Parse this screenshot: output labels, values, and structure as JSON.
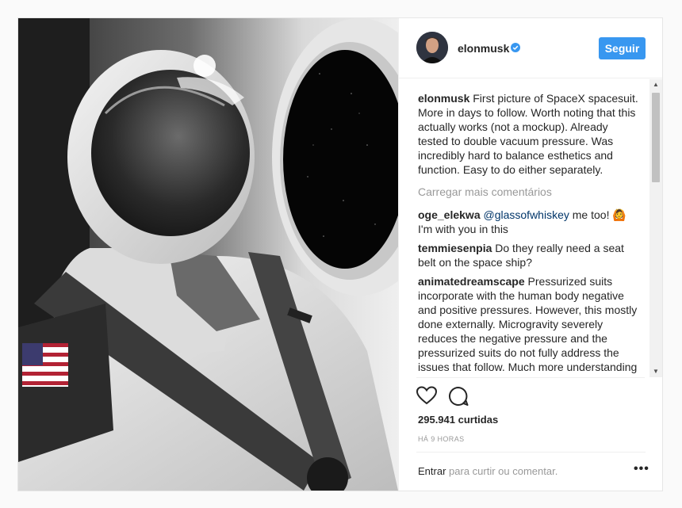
{
  "post": {
    "username": "elonmusk",
    "follow_label": "Seguir",
    "caption": {
      "username": "elonmusk",
      "text": "First picture of SpaceX spacesuit. More in days to follow. Worth noting that this actually works (not a mockup). Already tested to double vacuum pressure. Was incredibly hard to balance esthetics and function. Easy to do either separately."
    },
    "load_more_label": "Carregar mais comentários",
    "comments": [
      {
        "username": "oge_elekwa",
        "mention": "@glassofwhiskey",
        "text": "me too! 🙆 I'm with you in this"
      },
      {
        "username": "temmiesenpia",
        "mention": "",
        "text": "Do they really need a seat belt on the space ship?"
      },
      {
        "username": "animatedreamscape",
        "mention": "",
        "text": "Pressurized suits incorporate with the human body negative and positive pressures. However, this mostly done externally. Microgravity severely reduces the negative pressure and the pressurized suits do not fully address the issues that follow. Much more understanding of pressure integration is"
      }
    ],
    "likes": "295.941 curtidas",
    "time": "HÁ 9 HORAS",
    "login_link": "Entrar",
    "login_text": "para curtir ou comentar.",
    "more_options": "•••"
  },
  "icons": {
    "verified": "verified-badge-icon",
    "like": "heart-icon",
    "comment": "comment-icon",
    "more": "more-options-icon"
  },
  "colors": {
    "accent": "#3897f0",
    "muted": "#999999",
    "text": "#262626"
  }
}
